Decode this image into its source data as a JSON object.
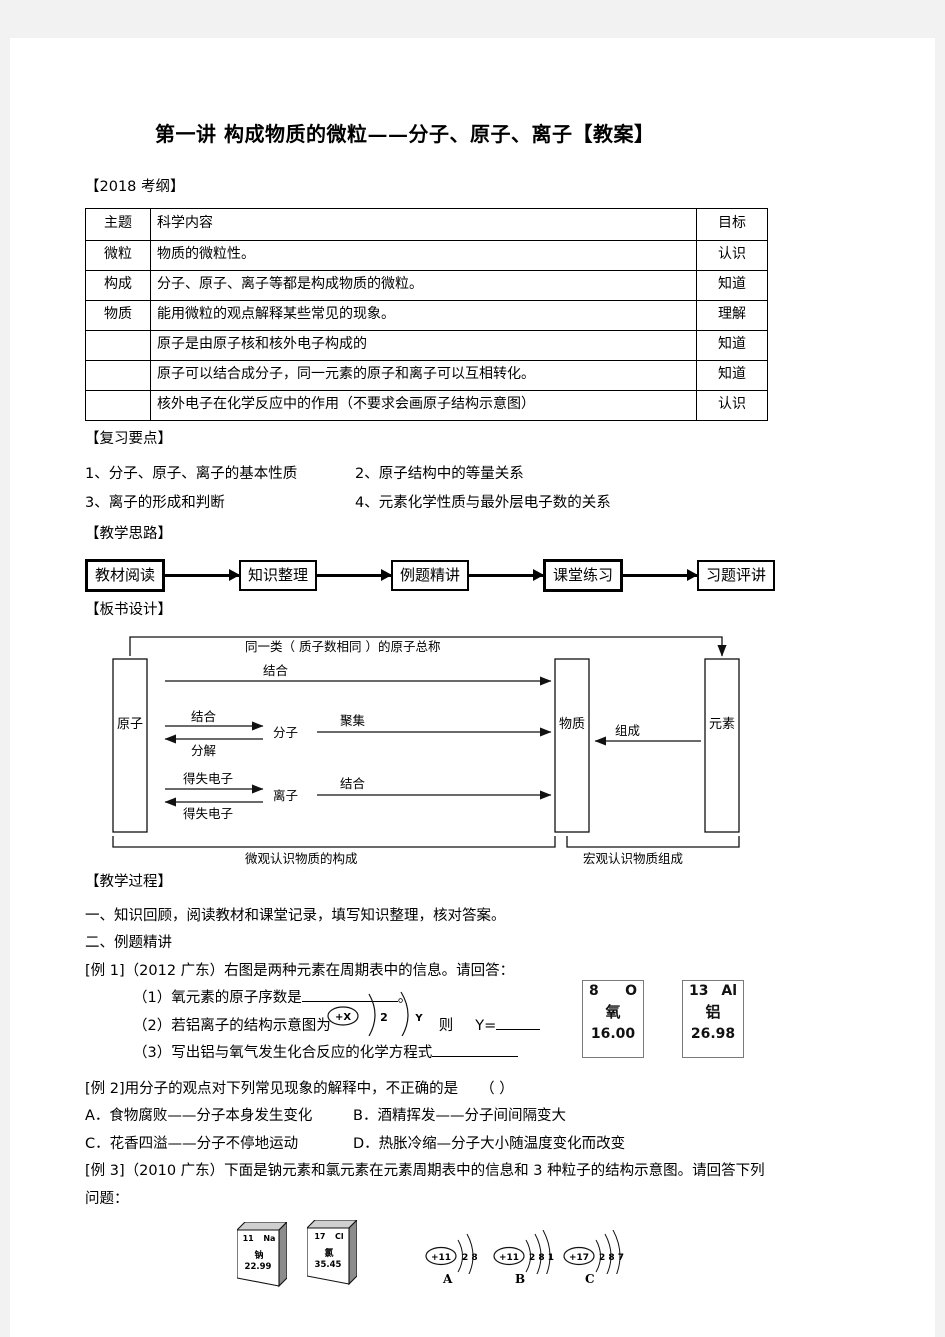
{
  "document": {
    "title": "第一讲 构成物质的微粒——分子、原子、离子【教案】"
  },
  "syllabus": {
    "heading": "【2018 考纲】",
    "columns": [
      "主题",
      "科学内容",
      "目标"
    ],
    "topic_label_lines": [
      "微粒",
      "构成",
      "物质"
    ],
    "rows": [
      {
        "content": "物质的微粒性。",
        "goal": "认识"
      },
      {
        "content": "分子、原子、离子等都是构成物质的微粒。",
        "goal": "知道"
      },
      {
        "content": "能用微粒的观点解释某些常见的现象。",
        "goal": "理解"
      },
      {
        "content": "原子是由原子核和核外电子构成的",
        "goal": "知道"
      },
      {
        "content": "原子可以结合成分子，同一元素的原子和离子可以互相转化。",
        "goal": "知道"
      },
      {
        "content": "核外电子在化学反应中的作用（不要求会画原子结构示意图）",
        "goal": "认识"
      }
    ]
  },
  "review": {
    "heading": "【复习要点】",
    "items": [
      "1、分子、原子、离子的基本性质",
      "2、原子结构中的等量关系",
      "3、离子的形成和判断",
      "4、元素化学性质与最外层电子数的关系"
    ]
  },
  "teaching_flow": {
    "heading": "【教学思路】",
    "steps": [
      "教材阅读",
      "知识整理",
      "例题精讲",
      "课堂练习",
      "习题评讲"
    ]
  },
  "board_design": {
    "heading": "【板书设计】",
    "top_label": "同一类（ 质子数相同 ）的原子总称",
    "boxes": {
      "atom": "原子",
      "substance": "物质",
      "element": "元素"
    },
    "nodes": {
      "molecule": "分子",
      "ion": "离子"
    },
    "arrow_labels": {
      "combine_top": "结合",
      "combine_mol": "结合",
      "decompose": "分解",
      "aggregate": "聚集",
      "gain_lose_1": "得失电子",
      "gain_lose_2": "得失电子",
      "combine_ion": "结合",
      "compose": "组成"
    },
    "brackets": {
      "micro": "微观认识物质的构成",
      "macro": "宏观认识物质组成"
    }
  },
  "teaching_process": {
    "heading": "【教学过程】",
    "step1": "一、知识回顾，阅读教材和课堂记录，填写知识整理，核对答案。",
    "step2": "二、例题精讲"
  },
  "example1": {
    "stem": "[例 1]（2012 广东）右图是两种元素在周期表中的信息。请回答：",
    "q1_pre": "（1）氧元素的原子序数是",
    "q1_post": "。",
    "q2_pre": "（2）若铝离子的结构示意图为",
    "q2_mid": "则",
    "q2_post": "Y=",
    "q3_pre": "（3）写出铝与氧气发生化合反应的化学方程式",
    "ion_sketch": {
      "nucleus": "+X",
      "shell1": "2",
      "shell2": "Y"
    },
    "element_cards": [
      {
        "number": "8",
        "symbol": "O",
        "name": "氧",
        "mass": "16.00"
      },
      {
        "number": "13",
        "symbol": "Al",
        "name": "铝",
        "mass": "26.98"
      }
    ]
  },
  "example2": {
    "stem": "[例 2]用分子的观点对下列常见现象的解释中，不正确的是",
    "bracket": "（       ）",
    "options": [
      "A．食物腐败——分子本身发生变化",
      "B．酒精挥发——分子间间隔变大",
      "C．花香四溢——分子不停地运动",
      "D．热胀冷缩—分子大小随温度变化而改变"
    ]
  },
  "example3": {
    "stem_line1": "[例 3]（2010 广东）下面是钠元素和氯元素在元素周期表中的信息和 3 种粒子的结构示意图。请回答下列",
    "stem_line2": "问题：",
    "element_cards": [
      {
        "number": "11",
        "symbol": "Na",
        "name": "钠",
        "mass": "22.99"
      },
      {
        "number": "17",
        "symbol": "Cl",
        "name": "氯",
        "mass": "35.45"
      }
    ],
    "particles": [
      {
        "label": "A",
        "nucleus": "+11",
        "shells": "2 8"
      },
      {
        "label": "B",
        "nucleus": "+11",
        "shells": "2 8 1"
      },
      {
        "label": "C",
        "nucleus": "+17",
        "shells": "2 8 7"
      }
    ]
  },
  "colors": {
    "page_bg": "#f2f2f2",
    "paper": "#ffffff",
    "ink": "#000000",
    "card_border": "#7a7a7a"
  }
}
